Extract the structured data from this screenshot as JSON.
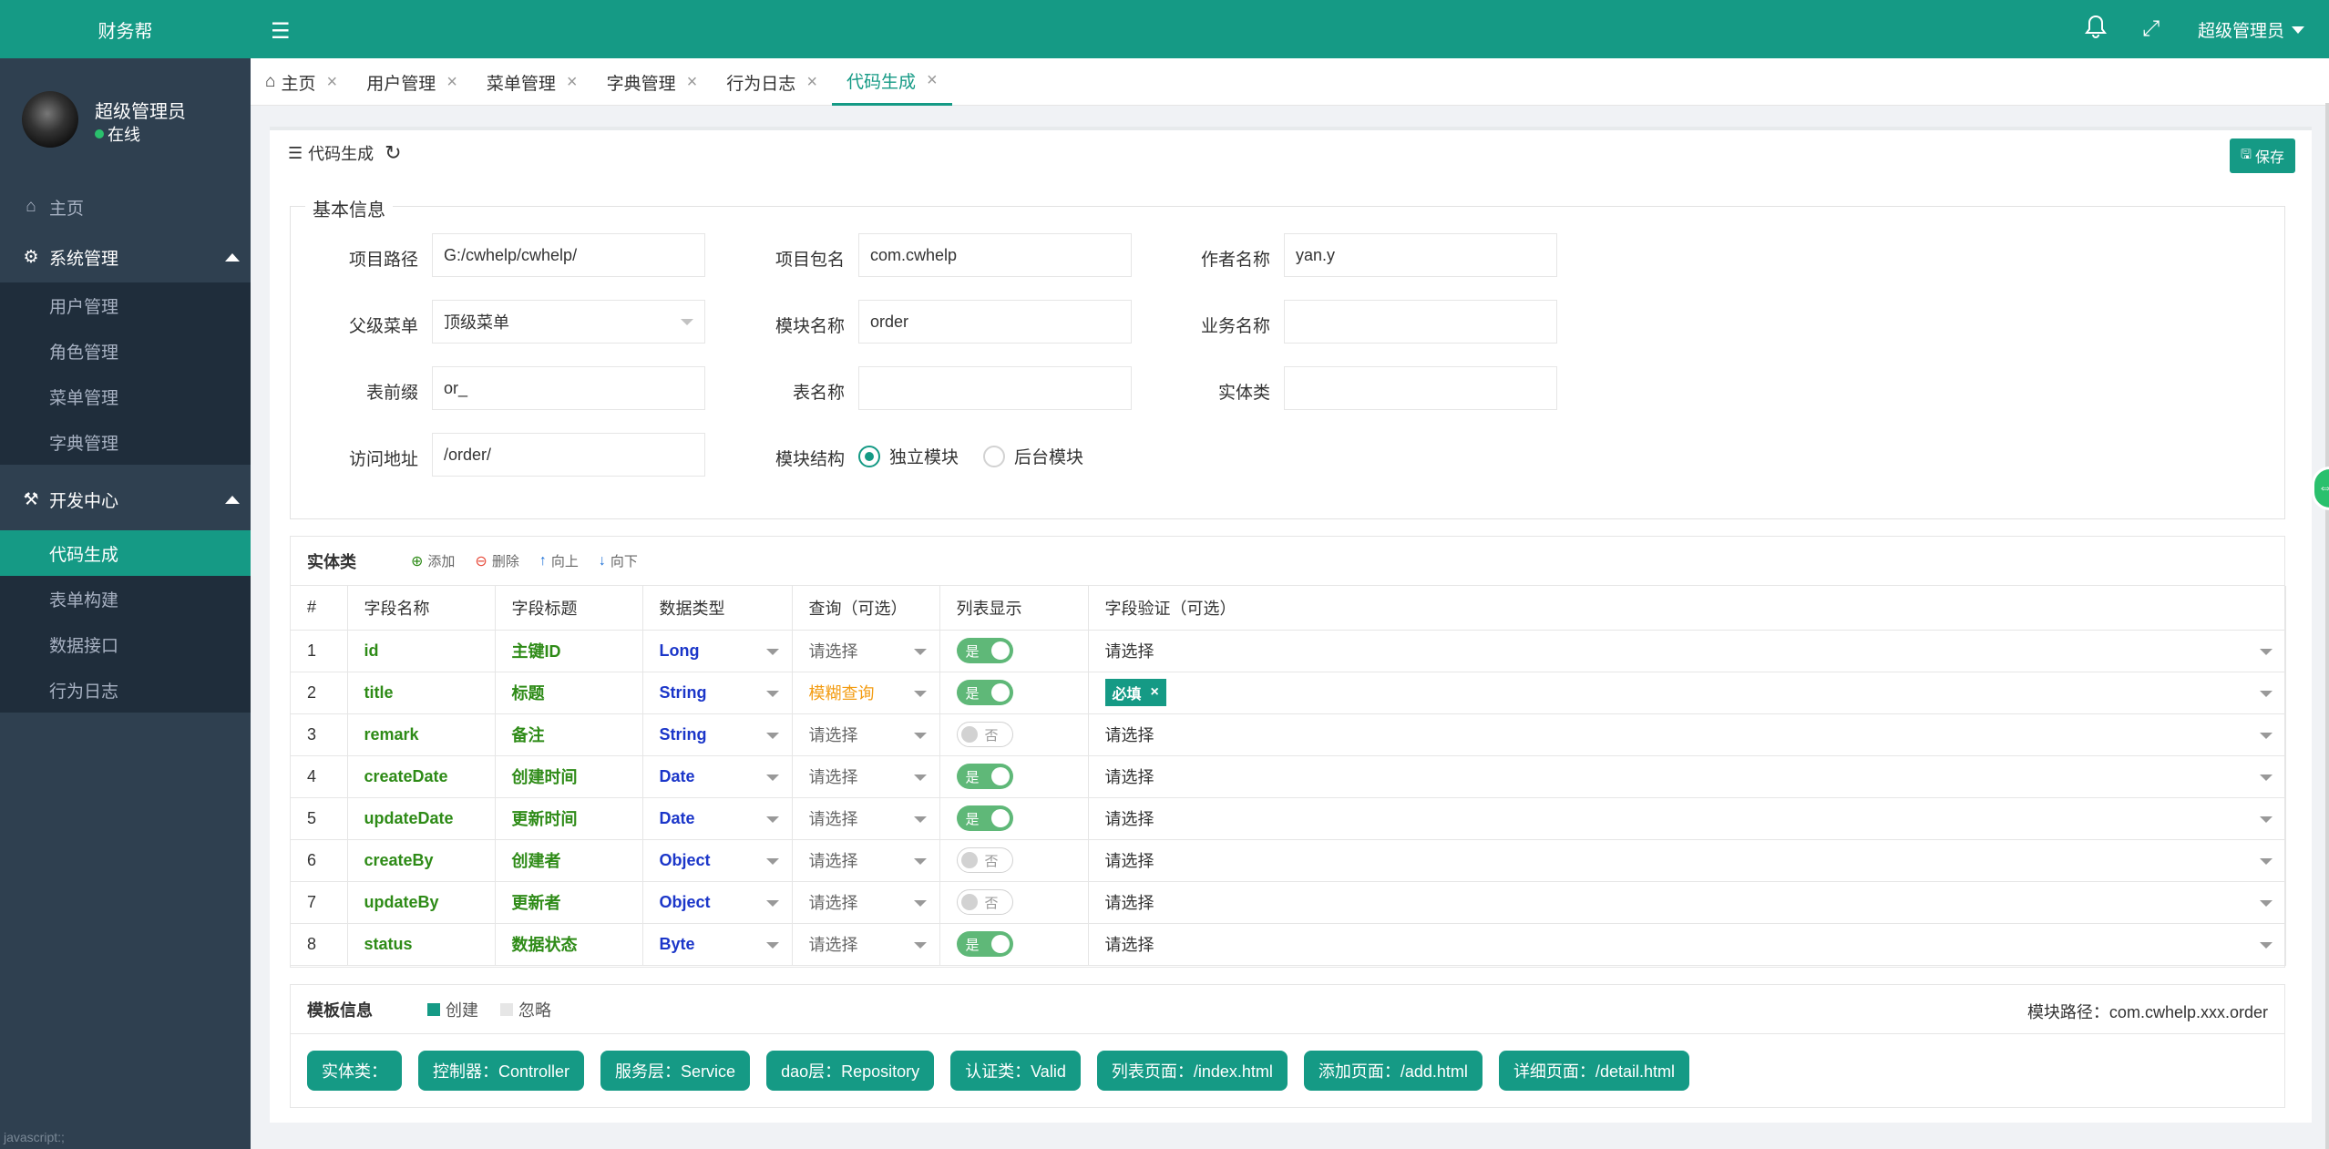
{
  "app": {
    "logo": "财务帮"
  },
  "user": {
    "name": "超级管理员",
    "status": "在线"
  },
  "sidebar": {
    "home": "主页",
    "groups": [
      {
        "label": "系统管理",
        "items": [
          "用户管理",
          "角色管理",
          "菜单管理",
          "字典管理"
        ]
      },
      {
        "label": "开发中心",
        "items": [
          "代码生成",
          "表单构建",
          "数据接口",
          "行为日志"
        ]
      }
    ],
    "footer": "javascript:;"
  },
  "header": {
    "user": "超级管理员"
  },
  "tabs": [
    "主页",
    "用户管理",
    "菜单管理",
    "字典管理",
    "行为日志",
    "代码生成"
  ],
  "card": {
    "title": "代码生成",
    "save": "保存"
  },
  "basic": {
    "legend": "基本信息",
    "fields": {
      "project_path": {
        "label": "项目路径",
        "value": "G:/cwhelp/cwhelp/"
      },
      "package": {
        "label": "项目包名",
        "value": "com.cwhelp"
      },
      "author": {
        "label": "作者名称",
        "value": "yan.y"
      },
      "parent_menu": {
        "label": "父级菜单",
        "value": "顶级菜单"
      },
      "module_name": {
        "label": "模块名称",
        "value": "order"
      },
      "business_name": {
        "label": "业务名称",
        "value": ""
      },
      "table_prefix": {
        "label": "表前缀",
        "value": "or_"
      },
      "table_name": {
        "label": "表名称",
        "value": ""
      },
      "entity": {
        "label": "实体类",
        "value": ""
      },
      "url": {
        "label": "访问地址",
        "value": "/order/"
      },
      "structure": {
        "label": "模块结构",
        "options": [
          "独立模块",
          "后台模块"
        ]
      }
    }
  },
  "entity": {
    "title": "实体类",
    "buttons": {
      "add": "添加",
      "delete": "删除",
      "up": "向上",
      "down": "向下"
    },
    "columns": [
      "#",
      "字段名称",
      "字段标题",
      "数据类型",
      "查询（可选）",
      "列表显示",
      "字段验证（可选）"
    ],
    "switch_on": "是",
    "switch_off": "否",
    "rows": [
      {
        "no": "1",
        "name": "id",
        "title": "主键ID",
        "type": "Long",
        "query": "请选择",
        "show": true,
        "valid": "请选择"
      },
      {
        "no": "2",
        "name": "title",
        "title": "标题",
        "type": "String",
        "query": "模糊查询",
        "show": true,
        "valid": "必填"
      },
      {
        "no": "3",
        "name": "remark",
        "title": "备注",
        "type": "String",
        "query": "请选择",
        "show": false,
        "valid": "请选择"
      },
      {
        "no": "4",
        "name": "createDate",
        "title": "创建时间",
        "type": "Date",
        "query": "请选择",
        "show": true,
        "valid": "请选择"
      },
      {
        "no": "5",
        "name": "updateDate",
        "title": "更新时间",
        "type": "Date",
        "query": "请选择",
        "show": true,
        "valid": "请选择"
      },
      {
        "no": "6",
        "name": "createBy",
        "title": "创建者",
        "type": "Object",
        "query": "请选择",
        "show": false,
        "valid": "请选择"
      },
      {
        "no": "7",
        "name": "updateBy",
        "title": "更新者",
        "type": "Object",
        "query": "请选择",
        "show": false,
        "valid": "请选择"
      },
      {
        "no": "8",
        "name": "status",
        "title": "数据状态",
        "type": "Byte",
        "query": "请选择",
        "show": true,
        "valid": "请选择"
      }
    ]
  },
  "template": {
    "title": "模板信息",
    "legend": [
      "创建",
      "忽略"
    ],
    "module_path": "模块路径：com.cwhelp.xxx.order",
    "pills": [
      "实体类：",
      "控制器：Controller",
      "服务层：Service",
      "dao层：Repository",
      "认证类：Valid",
      "列表页面：/index.html",
      "添加页面：/add.html",
      "详细页面：/detail.html"
    ]
  },
  "colors": {
    "primary": "#159a85",
    "sidebar": "#2f4050",
    "switch_on": "#5fb878"
  }
}
